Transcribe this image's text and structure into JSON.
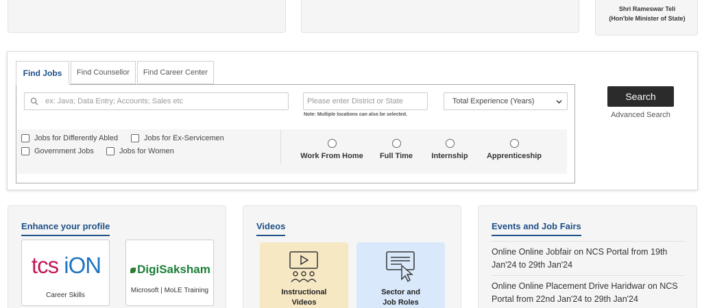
{
  "top": {
    "minister_name": "Shri Rameswar Teli",
    "minister_title": "(Hon'ble Minister of State)"
  },
  "tabs": [
    {
      "label": "Find Jobs"
    },
    {
      "label": "Find Counsellor"
    },
    {
      "label": "Find Career Center"
    }
  ],
  "search": {
    "keyword_placeholder": "ex: Java; Data Entry; Accounts; Sales etc",
    "location_placeholder": "Please enter District or State",
    "location_note": "Note: Multiple locations can also be selected.",
    "experience_selected": "Total Experience (Years)",
    "checkboxes": [
      {
        "label": "Jobs for Differently Abled"
      },
      {
        "label": "Jobs for Ex-Servicemen"
      },
      {
        "label": "Government Jobs"
      },
      {
        "label": "Jobs for Women"
      }
    ],
    "job_types": [
      {
        "label": "Work From Home"
      },
      {
        "label": "Full Time"
      },
      {
        "label": "Internship"
      },
      {
        "label": "Apprenticeship"
      }
    ],
    "search_button": "Search",
    "advanced_link": "Advanced Search"
  },
  "enhance": {
    "title": "Enhance your profile",
    "tcs_logo_part1": "tcs",
    "tcs_logo_part2": "iON",
    "tcs_caption": "Career Skills",
    "digi_logo": "DigiSaksham",
    "digi_caption": "Microsoft | MoLE Training"
  },
  "videos": {
    "title": "Videos",
    "instructional_line1": "Instructional",
    "instructional_line2": "Videos",
    "sector_line1": "Sector and",
    "sector_line2": "Job Roles"
  },
  "events": {
    "title": "Events and Job Fairs",
    "items": [
      {
        "text": "Online Online Jobfair on NCS Portal from 19th Jan'24 to 29th Jan'24"
      },
      {
        "text": "Online Online Placement Drive Haridwar on NCS Portal from 22nd Jan'24 to 29th Jan'24"
      }
    ]
  },
  "colors": {
    "accent": "#1d4f87",
    "search_button_bg": "#2b2b2b",
    "instructional_bg": "#f7e8c4",
    "sector_bg": "#d9e9fb"
  },
  "icons": {
    "keyword": "search-icon",
    "experience": "chevron-down-icon",
    "instructional": "video-tutorial-icon",
    "sector": "presentation-pointer-icon"
  }
}
